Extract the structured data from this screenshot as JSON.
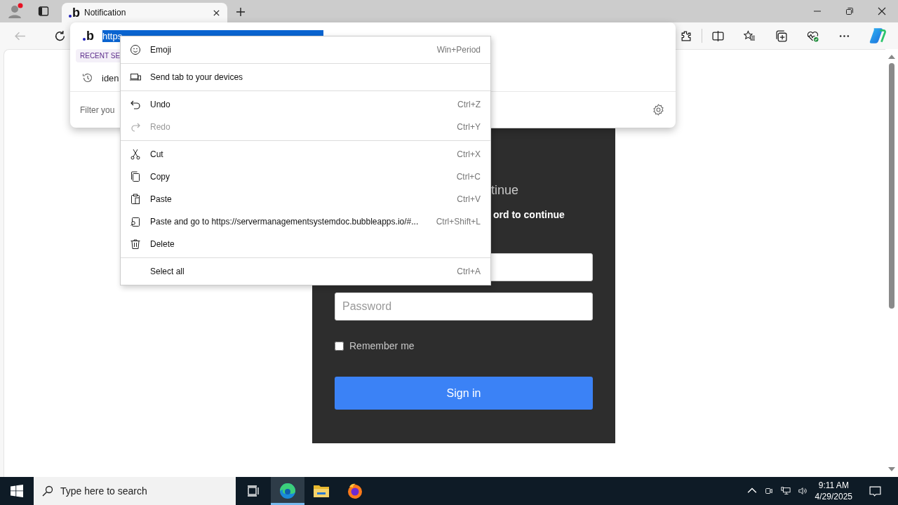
{
  "browser": {
    "tabs": [
      {
        "logo": "b",
        "title": "Notification",
        "selected": true
      }
    ]
  },
  "address_popup": {
    "logo": "b",
    "url": "https",
    "section_label": "RECENT SE",
    "history": [
      {
        "text": "iden"
      }
    ],
    "filter_placeholder": "Filter you"
  },
  "context_menu": {
    "groups": [
      [
        {
          "label": "Emoji",
          "shortcut": "Win+Period",
          "disabled": false
        }
      ],
      [
        {
          "label": "Send tab to your devices",
          "disabled": false
        }
      ],
      [
        {
          "label": "Undo",
          "shortcut": "Ctrl+Z",
          "disabled": false
        },
        {
          "label": "Redo",
          "shortcut": "Ctrl+Y",
          "disabled": true
        }
      ],
      [
        {
          "label": "Cut",
          "shortcut": "Ctrl+X",
          "disabled": false
        },
        {
          "label": "Copy",
          "shortcut": "Ctrl+C",
          "disabled": false
        },
        {
          "label": "Paste",
          "shortcut": "Ctrl+V",
          "disabled": false
        },
        {
          "label": "Paste and go to https://servermanagementsystemdoc.bubbleapps.io/#...",
          "shortcut": "Ctrl+Shift+L",
          "disabled": false
        },
        {
          "label": "Delete",
          "disabled": false
        }
      ],
      [
        {
          "label": "Select all",
          "shortcut": "Ctrl+A",
          "disabled": false
        }
      ]
    ]
  },
  "login": {
    "heading": "tinue",
    "subtitle": "ord to continue",
    "password_placeholder": "Password",
    "remember": {
      "label": "Remember me",
      "checked": false
    },
    "button": "Sign in"
  },
  "taskbar": {
    "search_placeholder": "Type here to search",
    "apps": [
      {
        "selected": true
      },
      {
        "selected": false
      },
      {
        "selected": false
      }
    ],
    "time": "9:11 AM",
    "date": "4/29/2025"
  }
}
